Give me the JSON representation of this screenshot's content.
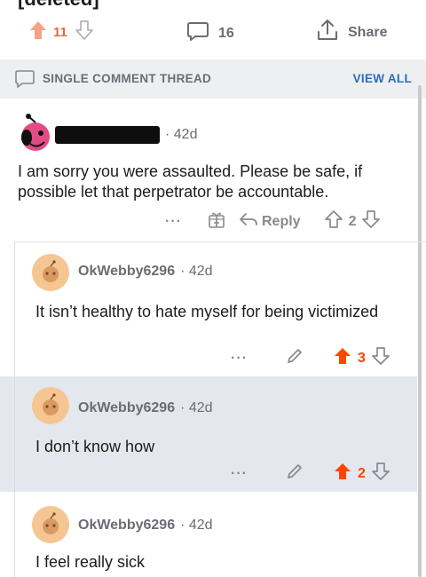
{
  "post": {
    "top_text": "[deleted]",
    "upvotes": "11",
    "comments": "16",
    "share_label": "Share"
  },
  "thread_header": {
    "title": "SINGLE COMMENT THREAD",
    "view_all": "VIEW ALL"
  },
  "comments": [
    {
      "age": "· 42d",
      "body": "I am sorry you were assaulted. Please be safe, if possible let that perpetrator be accountable.",
      "more": "···",
      "reply_label": "Reply",
      "score": "2"
    },
    {
      "author": "OkWebby6296",
      "age": "· 42d",
      "body": "It isn’t healthy to hate myself for being victimized",
      "more": "···",
      "score": "3"
    },
    {
      "author": "OkWebby6296",
      "age": "· 42d",
      "body": "I don’t know how",
      "more": "···",
      "score": "2"
    },
    {
      "author": "OkWebby6296",
      "age": "· 42d",
      "body": "I feel really sick"
    }
  ],
  "colors": {
    "accent_orange": "#e8683a",
    "upvote_red": "#ff4500",
    "link_blue": "#2b6cb5",
    "muted": "#878a8c"
  }
}
